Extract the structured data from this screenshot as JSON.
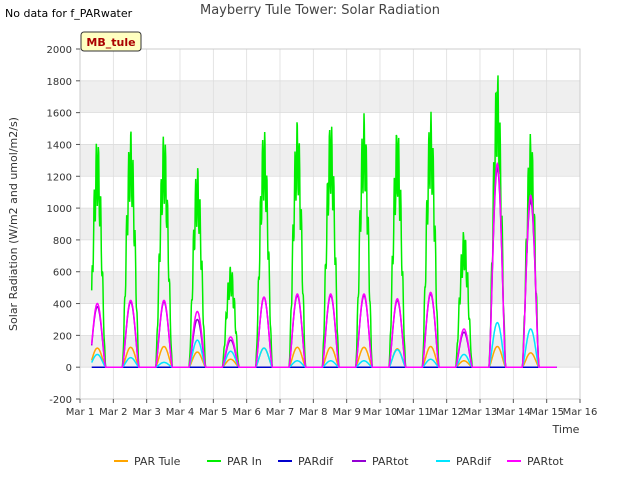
{
  "header": {
    "nodata_text": "No data for f_PARwater",
    "title": "Mayberry Tule Tower: Solar Radiation"
  },
  "chart_data": {
    "type": "line",
    "title": "Mayberry Tule Tower: Solar Radiation",
    "xlabel": "Time",
    "ylabel": "Solar Radiation (W/m2 and umol/m2/s)",
    "site_label": "MB_tule",
    "xlim": [
      1,
      16
    ],
    "ylim": [
      -200,
      2000
    ],
    "x_ticks": [
      "Mar 1",
      "Mar 2",
      "Mar 3",
      "Mar 4",
      "Mar 5",
      "Mar 6",
      "Mar 7",
      "Mar 8",
      "Mar 9",
      "Mar 10",
      "Mar 11",
      "Mar 12",
      "Mar 13",
      "Mar 14",
      "Mar 15",
      "Mar 16"
    ],
    "y_ticks": [
      -200,
      0,
      200,
      400,
      600,
      800,
      1000,
      1200,
      1400,
      1600,
      1800,
      2000
    ],
    "grid": true,
    "legend_position": "bottom",
    "data_start": 1.35,
    "data_end": 15.3,
    "series": [
      {
        "name": "PAR Tule",
        "color": "#ffa500",
        "daily_peaks": [
          120,
          125,
          130,
          95,
          50,
          120,
          125,
          125,
          125,
          115,
          130,
          40,
          130,
          90
        ]
      },
      {
        "name": "PAR In",
        "color": "#00ee00",
        "daily_peaks": [
          1440,
          1500,
          1470,
          1270,
          640,
          1500,
          1560,
          1550,
          1600,
          1510,
          1610,
          860,
          1860,
          1470
        ]
      },
      {
        "name": "PARdif",
        "color": "#0000cd",
        "daily_peaks": [
          0,
          0,
          0,
          0,
          0,
          0,
          0,
          0,
          0,
          0,
          0,
          0,
          0,
          0
        ]
      },
      {
        "name": "PARtot",
        "color": "#9400d3",
        "daily_peaks": [
          380,
          410,
          410,
          300,
          170,
          440,
          450,
          450,
          450,
          420,
          460,
          220,
          1250,
          1050
        ]
      },
      {
        "name": "PARdif",
        "color": "#00e5ff",
        "daily_peaks": [
          80,
          60,
          30,
          170,
          100,
          120,
          40,
          40,
          40,
          110,
          50,
          80,
          280,
          240
        ]
      },
      {
        "name": "PARtot",
        "color": "#ff00ff",
        "daily_peaks": [
          400,
          420,
          420,
          350,
          190,
          440,
          460,
          460,
          460,
          430,
          470,
          240,
          1280,
          1080
        ]
      }
    ]
  }
}
